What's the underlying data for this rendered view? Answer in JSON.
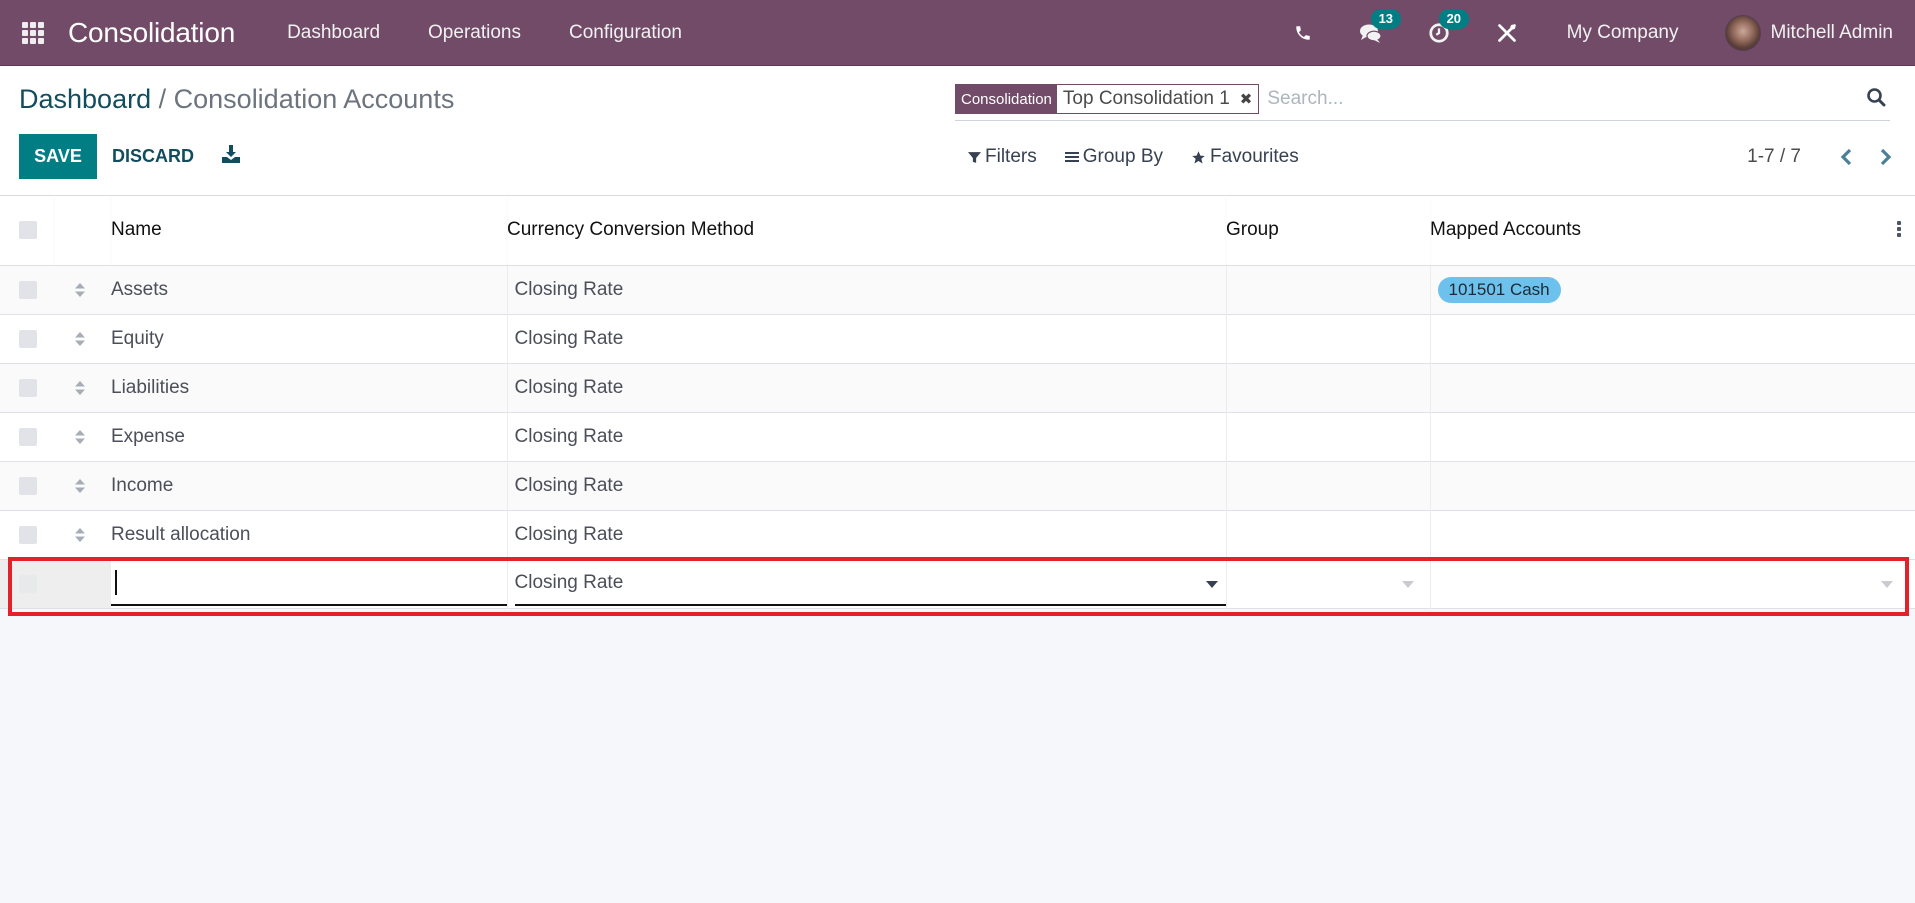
{
  "navbar": {
    "app_title": "Consolidation",
    "menu": [
      "Dashboard",
      "Operations",
      "Configuration"
    ],
    "messages_count": "13",
    "activities_count": "20",
    "company": "My Company",
    "user": "Mitchell Admin",
    "icons": [
      "apps-grid-icon",
      "phone-icon",
      "chat-icon",
      "activity-clock-icon",
      "debug-tools-icon"
    ]
  },
  "breadcrumb": {
    "parent": "Dashboard",
    "separator": "/",
    "current": "Consolidation Accounts"
  },
  "actions": {
    "save": "SAVE",
    "discard": "DISCARD"
  },
  "search": {
    "facet_category": "Consolidation",
    "facet_value": "Top Consolidation 1",
    "facet_remove": "✖",
    "placeholder": "Search...",
    "value": ""
  },
  "filters": {
    "filters_label": "Filters",
    "group_by_label": "Group By",
    "favourites_label": "Favourites"
  },
  "pager": {
    "value": "1-7 / 7"
  },
  "table": {
    "columns": [
      "Name",
      "Currency Conversion Method",
      "Group",
      "Mapped Accounts"
    ],
    "rows": [
      {
        "name": "Assets",
        "currency_method": "Closing Rate",
        "group": "",
        "mapped_accounts": [
          "101501 Cash"
        ]
      },
      {
        "name": "Equity",
        "currency_method": "Closing Rate",
        "group": "",
        "mapped_accounts": []
      },
      {
        "name": "Liabilities",
        "currency_method": "Closing Rate",
        "group": "",
        "mapped_accounts": []
      },
      {
        "name": "Expense",
        "currency_method": "Closing Rate",
        "group": "",
        "mapped_accounts": []
      },
      {
        "name": "Income",
        "currency_method": "Closing Rate",
        "group": "",
        "mapped_accounts": []
      },
      {
        "name": "Result allocation",
        "currency_method": "Closing Rate",
        "group": "",
        "mapped_accounts": []
      }
    ],
    "new_row": {
      "name": "",
      "currency_method": "Closing Rate",
      "group": "",
      "mapped_accounts": ""
    }
  },
  "colors": {
    "navbar": "#714b67",
    "primary": "#017e84",
    "link": "#114d5e",
    "tag": "#6cc1ed",
    "highlight": "#e3212a"
  }
}
